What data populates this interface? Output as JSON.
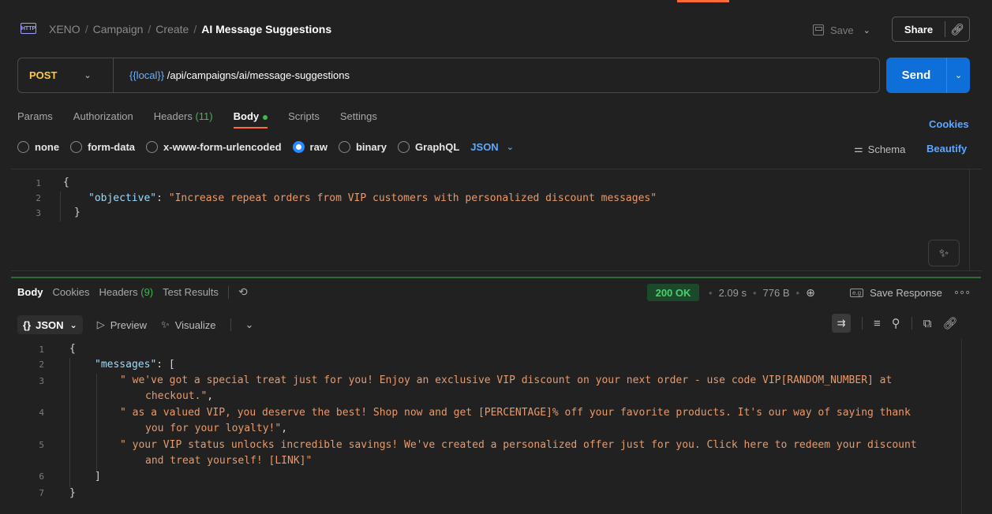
{
  "header": {
    "http_badge": "HTTP",
    "breadcrumb": [
      "XENO",
      "Campaign",
      "Create"
    ],
    "breadcrumb_sep": "/",
    "title": "AI Message Suggestions",
    "save_label": "Save",
    "share_label": "Share"
  },
  "request": {
    "method": "POST",
    "url_var": "{{local}}",
    "url_path": " /api/campaigns/ai/message-suggestions",
    "send_label": "Send",
    "tabs": [
      {
        "label": "Params"
      },
      {
        "label": "Authorization"
      },
      {
        "label": "Headers",
        "count": "(11)"
      },
      {
        "label": "Body"
      },
      {
        "label": "Scripts"
      },
      {
        "label": "Settings"
      }
    ],
    "cookies_label": "Cookies",
    "body_types": [
      "none",
      "form-data",
      "x-www-form-urlencoded",
      "raw",
      "binary",
      "GraphQL"
    ],
    "body_type_selected": "raw",
    "format": "JSON",
    "schema_label": "Schema",
    "beautify_label": "Beautify",
    "body_lines": [
      {
        "n": "1",
        "brace": "{"
      },
      {
        "n": "2",
        "key": "\"objective\"",
        "colon": ": ",
        "value": "\"Increase repeat orders from VIP customers with personalized discount messages\""
      },
      {
        "n": "3",
        "brace": "}"
      }
    ]
  },
  "response": {
    "tabs": [
      {
        "label": "Body"
      },
      {
        "label": "Cookies"
      },
      {
        "label": "Headers",
        "count": "(9)"
      },
      {
        "label": "Test Results"
      }
    ],
    "status": "200 OK",
    "time": "2.09 s",
    "size": "776 B",
    "save_response_label": "Save Response",
    "mode": "JSON",
    "preview_label": "Preview",
    "visualize_label": "Visualize",
    "lines": [
      {
        "n": "1",
        "text": "{"
      },
      {
        "n": "2",
        "key": "\"messages\"",
        "rest": ": ["
      },
      {
        "n": "3",
        "str": "\" we've got a special treat just for you! Enjoy an exclusive VIP discount on your next order - use code VIP[RANDOM_NUMBER] at"
      },
      {
        "n": "",
        "str": "checkout.\"",
        "punct": ","
      },
      {
        "n": "4",
        "str": "\" as a valued VIP, you deserve the best! Shop now and get [PERCENTAGE]% off your favorite products. It's our way of saying thank"
      },
      {
        "n": "",
        "str": "you for your loyalty!\"",
        "punct": ","
      },
      {
        "n": "5",
        "str": "\" your VIP status unlocks incredible savings! We've created a personalized offer just for you. Click here to redeem your discount"
      },
      {
        "n": "",
        "str": "and treat yourself! [LINK]\""
      },
      {
        "n": "6",
        "text": "]"
      },
      {
        "n": "7",
        "text": "}"
      }
    ]
  }
}
